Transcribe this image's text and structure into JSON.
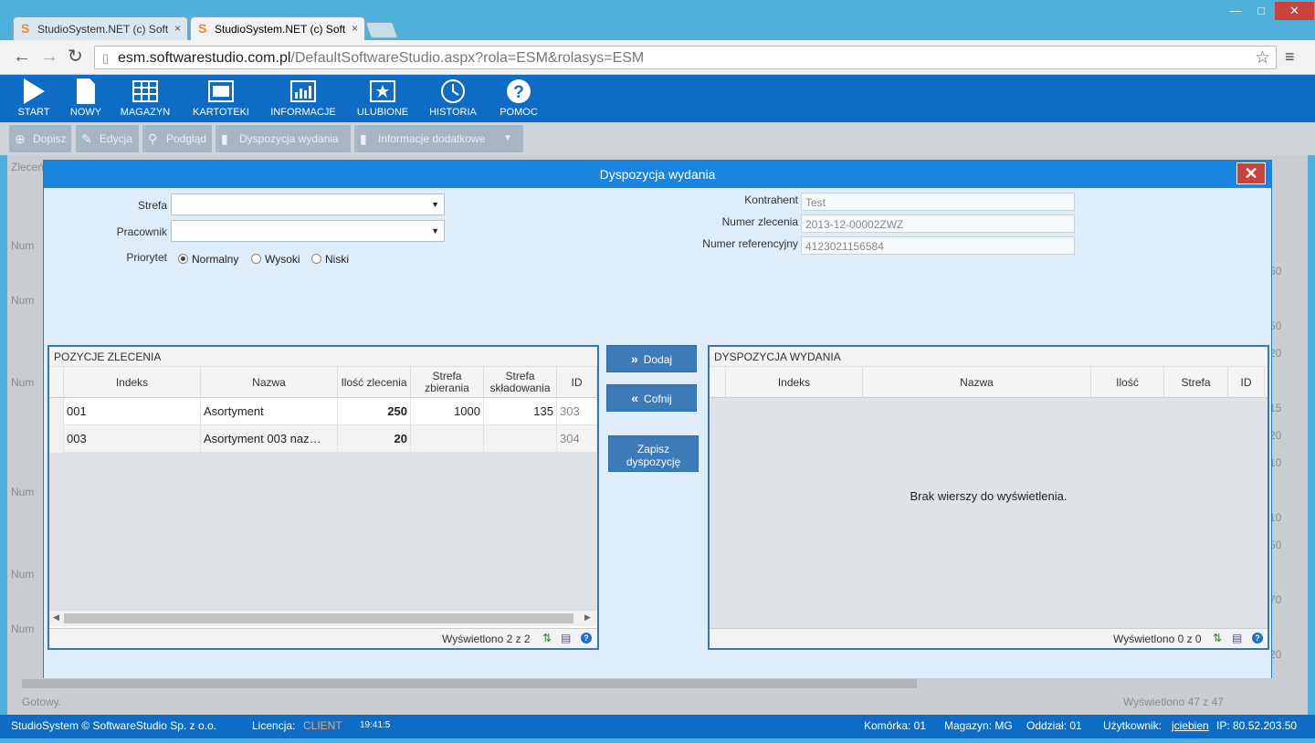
{
  "browser": {
    "tabs": [
      {
        "title": "StudioSystem.NET (c) Soft",
        "close": "×"
      },
      {
        "title": "StudioSystem.NET (c) Soft",
        "close": "×"
      }
    ],
    "window_controls": {
      "minimize": "—",
      "maximize": "□",
      "close": "✕"
    },
    "url_host": "esm.softwarestudio.com.pl",
    "url_path": "/DefaultSoftwareStudio.aspx?rola=ESM&rolasys=ESM"
  },
  "toolbar": {
    "items": [
      {
        "label": "START",
        "icon": "play-icon"
      },
      {
        "label": "NOWY",
        "icon": "new-document-icon"
      },
      {
        "label": "MAGAZYN",
        "icon": "warehouse-grid-icon"
      },
      {
        "label": "KARTOTEKI",
        "icon": "window-icon"
      },
      {
        "label": "INFORMACJE",
        "icon": "chart-icon"
      },
      {
        "label": "ULUBIONE",
        "icon": "star-icon"
      },
      {
        "label": "HISTORIA",
        "icon": "history-icon"
      },
      {
        "label": "POMOC",
        "icon": "help-icon"
      }
    ]
  },
  "actions": {
    "dopisz": "Dopisz",
    "edycja": "Edycja",
    "podglad": "Podgląd",
    "dyspozycja": "Dyspozycja wydania",
    "informacje": "Informacje dodatkowe"
  },
  "background": {
    "zlecen": "Zleceń",
    "nun": "Num",
    "gotowy": "Gotowy.",
    "wyswietlono": "Wyświetlono 47 z 47",
    "side_numbers": [
      "50",
      "50",
      "20",
      "15",
      "20",
      "10",
      "10",
      "50",
      "70",
      "20"
    ]
  },
  "modal": {
    "title": "Dyspozycja wydania",
    "close": "✕",
    "strefa_label": "Strefa",
    "pracownik_label": "Pracownik",
    "priorytet_label": "Priorytet",
    "priorities": [
      "Normalny",
      "Wysoki",
      "Niski"
    ],
    "selected_priority": "Normalny",
    "kontrahent_label": "Kontrahent",
    "kontrahent_value": "Test",
    "numer_zlecenia_label": "Numer zlecenia",
    "numer_zlecenia_value": "2013-12-00002ZWZ",
    "numer_ref_label": "Numer referencyjny",
    "numer_ref_value": "4123021156584",
    "left_grid": {
      "title": "POZYCJE ZLECENIA",
      "columns": [
        "Indeks",
        "Nazwa",
        "Ilość zlecenia",
        "Strefa zbierania",
        "Strefa składowania",
        "ID"
      ],
      "rows": [
        {
          "indeks": "001",
          "nazwa": "Asortyment",
          "ilosc": "250",
          "zbierania": "1000",
          "skladowania": "135",
          "id": "303"
        },
        {
          "indeks": "003",
          "nazwa": "Asortyment 003 naz…",
          "ilosc": "20",
          "zbierania": "",
          "skladowania": "",
          "id": "304"
        }
      ],
      "footer": "Wyświetlono 2 z 2"
    },
    "buttons": {
      "dodaj": "Dodaj",
      "cofnij": "Cofnij",
      "zapisz": "Zapisz dyspozycję"
    },
    "right_grid": {
      "title": "DYSPOZYCJA WYDANIA",
      "columns": [
        "Indeks",
        "Nazwa",
        "Ilość",
        "Strefa",
        "ID"
      ],
      "empty": "Brak wierszy do wyświetlenia.",
      "footer": "Wyświetlono 0 z 0"
    }
  },
  "status": {
    "copyright": "StudioSystem © SoftwareStudio Sp. z o.o.",
    "licencja_label": "Licencja:",
    "licencja_value": "CLIENT",
    "time": "19:41:5",
    "komorka": "Komórka: 01",
    "magazyn": "Magazyn: MG",
    "oddzial": "Oddział: 01",
    "uzytkownik_label": "Użytkownik:",
    "uzytkownik_value": "jciebien",
    "ip": "IP: 80.52.203.50"
  }
}
